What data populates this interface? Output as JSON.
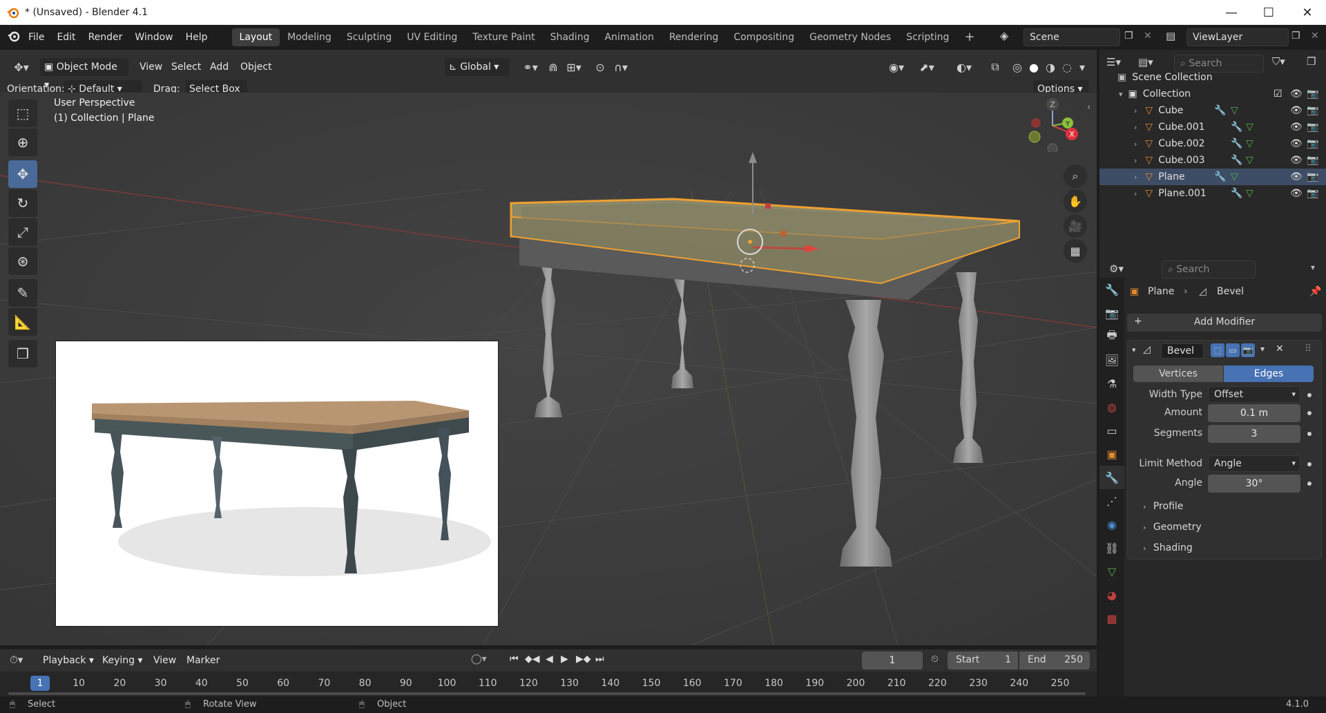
{
  "window": {
    "title": "* (Unsaved) - Blender 4.1",
    "minimize": "—",
    "maximize": "☐",
    "close": "✕"
  },
  "menus": [
    "File",
    "Edit",
    "Render",
    "Window",
    "Help"
  ],
  "workspaces": [
    "Layout",
    "Modeling",
    "Sculpting",
    "UV Editing",
    "Texture Paint",
    "Shading",
    "Animation",
    "Rendering",
    "Compositing",
    "Geometry Nodes",
    "Scripting"
  ],
  "workspace_add": "+",
  "scene": {
    "name": "Scene",
    "view_layer": "ViewLayer"
  },
  "viewport_header": {
    "mode": "Object Mode",
    "menu": [
      "View",
      "Select",
      "Add",
      "Object"
    ],
    "transform_orientation": "Global",
    "orientation_label": "Orientation:",
    "orientation_value": "Default",
    "drag_label": "Drag:",
    "drag_value": "Select Box",
    "options": "Options"
  },
  "viewport": {
    "view_name": "User Perspective",
    "view_info": "(1) Collection | Plane",
    "gizmo_axes": {
      "z": "Z",
      "y": "Y",
      "x": "X"
    }
  },
  "outliner": {
    "search_placeholder": "Search",
    "scene_collection": "Scene Collection",
    "collection": "Collection",
    "objects": [
      {
        "name": "Cube",
        "selected": false
      },
      {
        "name": "Cube.001",
        "selected": false
      },
      {
        "name": "Cube.002",
        "selected": false
      },
      {
        "name": "Cube.003",
        "selected": false
      },
      {
        "name": "Plane",
        "selected": true
      },
      {
        "name": "Plane.001",
        "selected": false
      }
    ]
  },
  "properties": {
    "search_placeholder": "Search",
    "breadcrumb_object": "Plane",
    "breadcrumb_modifier": "Bevel",
    "add_modifier": "Add Modifier",
    "modifier": {
      "name": "Bevel",
      "affect_options": [
        "Vertices",
        "Edges"
      ],
      "affect_selected": "Edges",
      "width_type_label": "Width Type",
      "width_type_value": "Offset",
      "amount_label": "Amount",
      "amount_value": "0.1 m",
      "segments_label": "Segments",
      "segments_value": "3",
      "limit_method_label": "Limit Method",
      "limit_method_value": "Angle",
      "angle_label": "Angle",
      "angle_value": "30°",
      "panels": [
        "Profile",
        "Geometry",
        "Shading"
      ]
    }
  },
  "timeline": {
    "menu": [
      "Playback",
      "Keying",
      "View",
      "Marker"
    ],
    "current_frame": "1",
    "start_label": "Start",
    "start_value": "1",
    "end_label": "End",
    "end_value": "250",
    "ruler": [
      "1",
      "10",
      "20",
      "30",
      "40",
      "50",
      "60",
      "70",
      "80",
      "90",
      "100",
      "110",
      "120",
      "130",
      "140",
      "150",
      "160",
      "170",
      "180",
      "190",
      "200",
      "210",
      "220",
      "230",
      "240",
      "250"
    ]
  },
  "statusbar": {
    "select": "Select",
    "rotate": "Rotate View",
    "object": "Object",
    "version": "4.1.0"
  },
  "colors": {
    "accent": "#4772b3",
    "selection_outline": "#f0a030",
    "active_row": "#3e4d66"
  }
}
